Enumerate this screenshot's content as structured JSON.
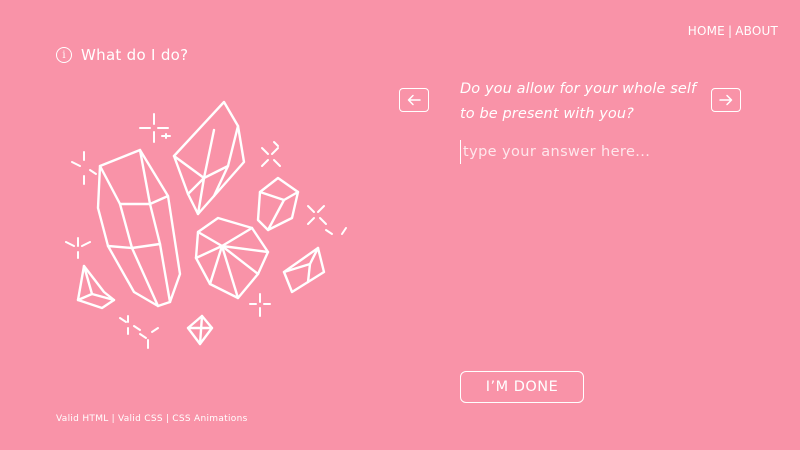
{
  "nav": {
    "home_label": "HOME",
    "separator": "|",
    "about_label": "ABOUT"
  },
  "help": {
    "icon_glyph": "i",
    "label": "What do I do?"
  },
  "illustration": {
    "icon": "crystals-illustration"
  },
  "question": {
    "prev_icon": "arrow-left-icon",
    "next_icon": "arrow-right-icon",
    "text": "Do you allow for your whole self to be present with you?"
  },
  "answer": {
    "value": "",
    "placeholder": "type your answer here..."
  },
  "done_button": {
    "label": "I’M DONE"
  },
  "footer": {
    "links": [
      "Valid HTML",
      "Valid CSS",
      "CSS Animations"
    ],
    "separator": "|"
  },
  "colors": {
    "background": "#f993a8",
    "foreground": "#ffffff"
  }
}
